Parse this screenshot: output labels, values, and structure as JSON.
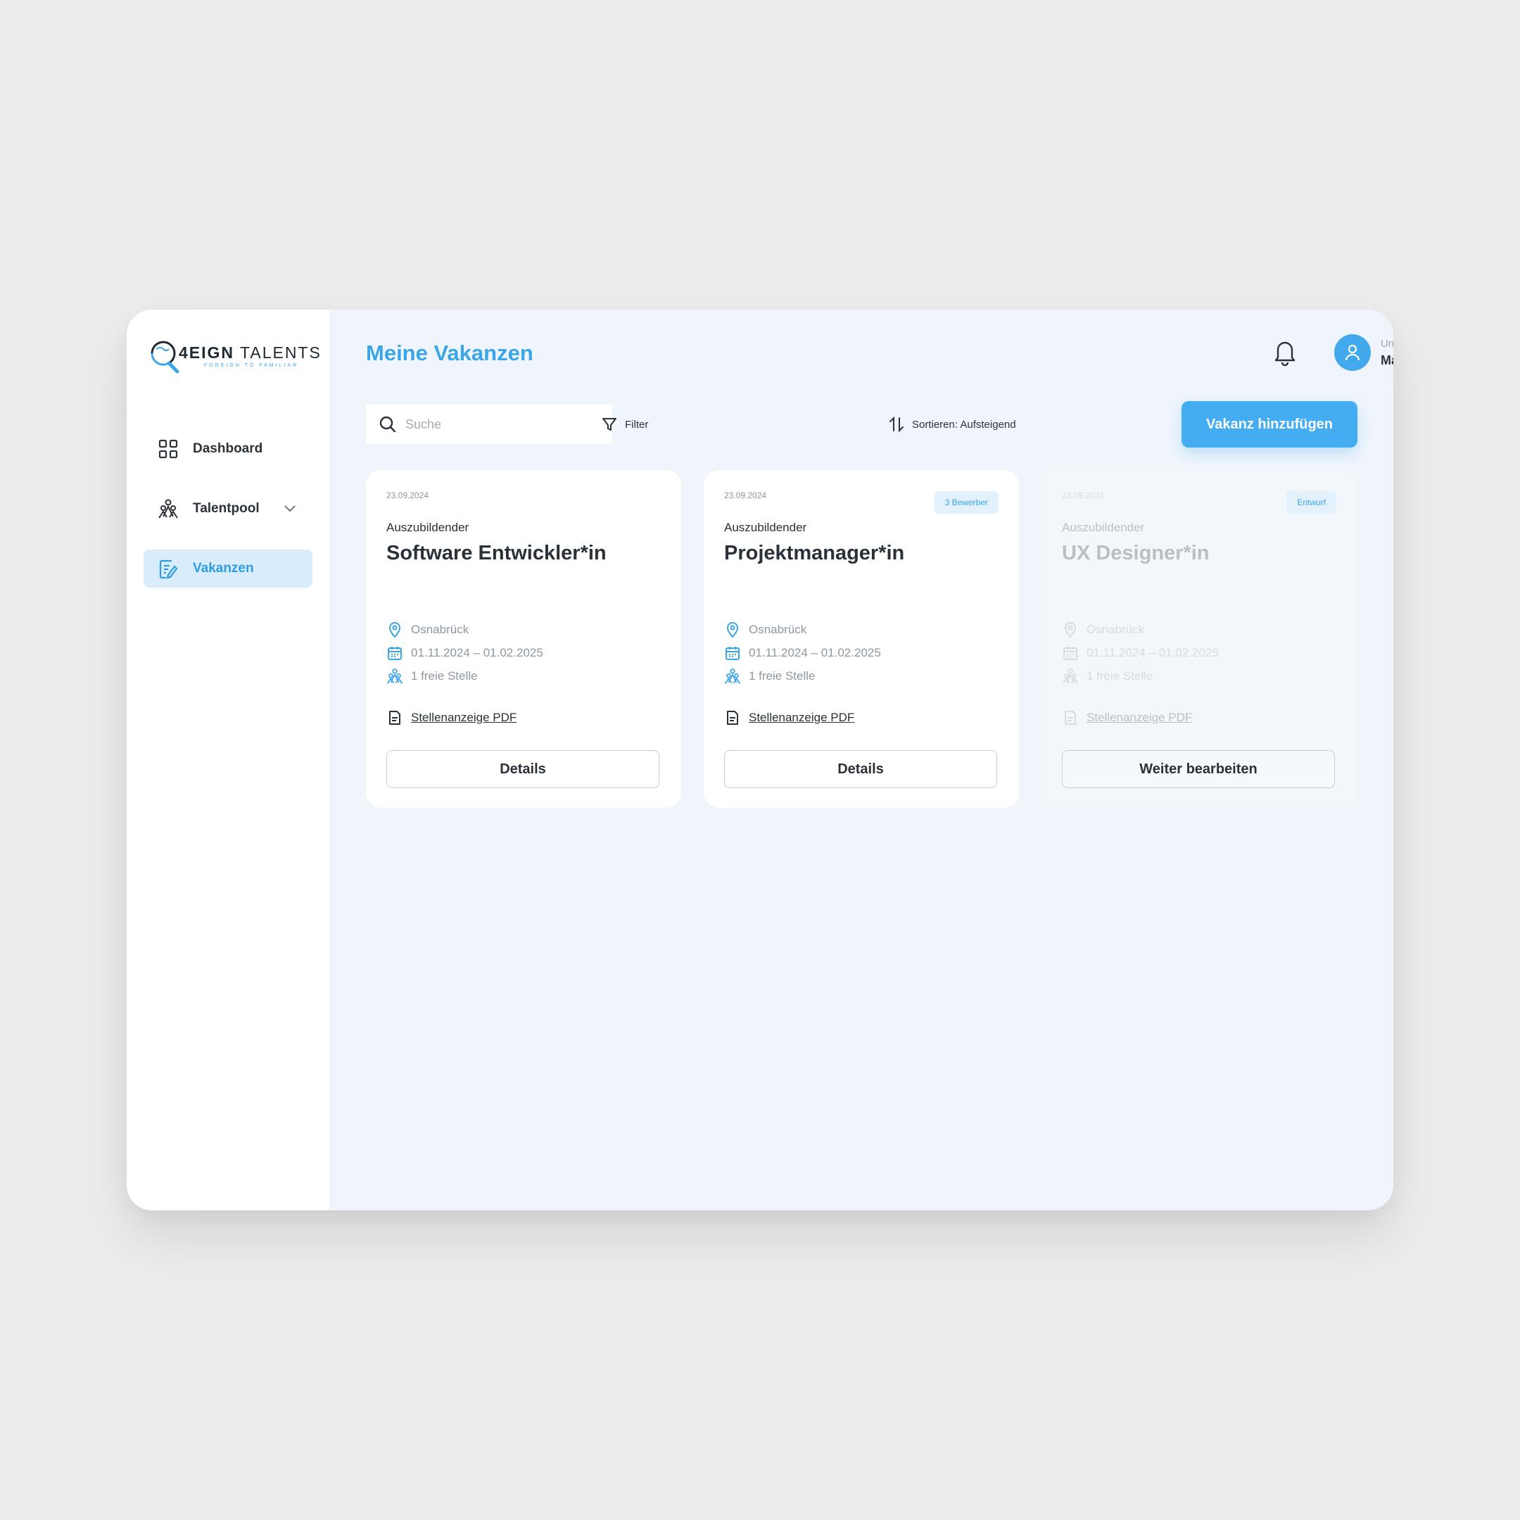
{
  "brand": {
    "name_bold": "4EIGN",
    "name_rest": " TALENTS",
    "tagline": "FOREIGN TO FAMILIAR",
    "accent": "#3aa6e8"
  },
  "sidebar": {
    "items": [
      {
        "label": "Dashboard",
        "icon": "grid-icon",
        "active": false
      },
      {
        "label": "Talentpool",
        "icon": "people-icon",
        "active": false,
        "expandable": true
      },
      {
        "label": "Vakanzen",
        "icon": "edit-document-icon",
        "active": true
      }
    ]
  },
  "header": {
    "title": "Meine Vakanzen",
    "user": {
      "company": "Unternehmen GmbH",
      "name": "Max Mustermann"
    }
  },
  "toolbar": {
    "search_placeholder": "Suche",
    "filter_label": "Filter",
    "sort_label": "Sortieren: Aufsteigend",
    "add_label": "Vakanz hinzufügen"
  },
  "cards": [
    {
      "date": "23.09.2024",
      "badge": "",
      "type": "Auszubildender",
      "title": "Software Entwickler*in",
      "location": "Osnabrück",
      "period": "01.11.2024 – 01.02.2025",
      "positions": "1 freie Stelle",
      "pdf_label": "Stellenanzeige PDF",
      "button": "Details",
      "draft": false
    },
    {
      "date": "23.09.2024",
      "badge": "3 Bewerber",
      "type": "Auszubildender",
      "title": "Projektmanager*in",
      "location": "Osnabrück",
      "period": "01.11.2024 – 01.02.2025",
      "positions": "1 freie Stelle",
      "pdf_label": "Stellenanzeige PDF",
      "button": "Details",
      "draft": false
    },
    {
      "date": "23.09.2024",
      "badge": "Entwurf",
      "type": "Auszubildender",
      "title": "UX Designer*in",
      "location": "Osnabrück",
      "period": "01.11.2024 – 01.02.2025",
      "positions": "1 freie Stelle",
      "pdf_label": "Stellenanzeige PDF",
      "button": "Weiter bearbeiten",
      "draft": true
    }
  ]
}
